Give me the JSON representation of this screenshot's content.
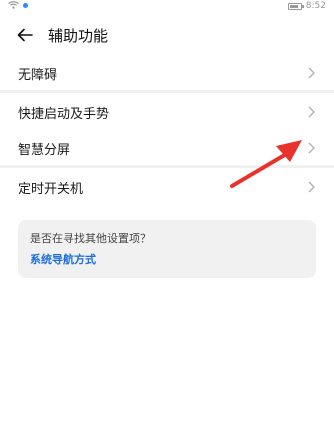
{
  "status": {
    "time": "8:52"
  },
  "header": {
    "title": "辅助功能"
  },
  "items": [
    {
      "label": "无障碍"
    },
    {
      "label": "快捷启动及手势"
    },
    {
      "label": "智慧分屏"
    },
    {
      "label": "定时开关机"
    }
  ],
  "help": {
    "question": "是否在寻找其他设置项？",
    "link": "系统导航方式"
  },
  "colors": {
    "accent": "#1d6de0",
    "annotation_arrow": "#e8322b",
    "status_dot": "#2f8cff"
  },
  "icons": {
    "back": "arrow-left-icon",
    "chevron": "chevron-right-icon",
    "wifi": "wifi-icon",
    "battery": "battery-icon"
  }
}
